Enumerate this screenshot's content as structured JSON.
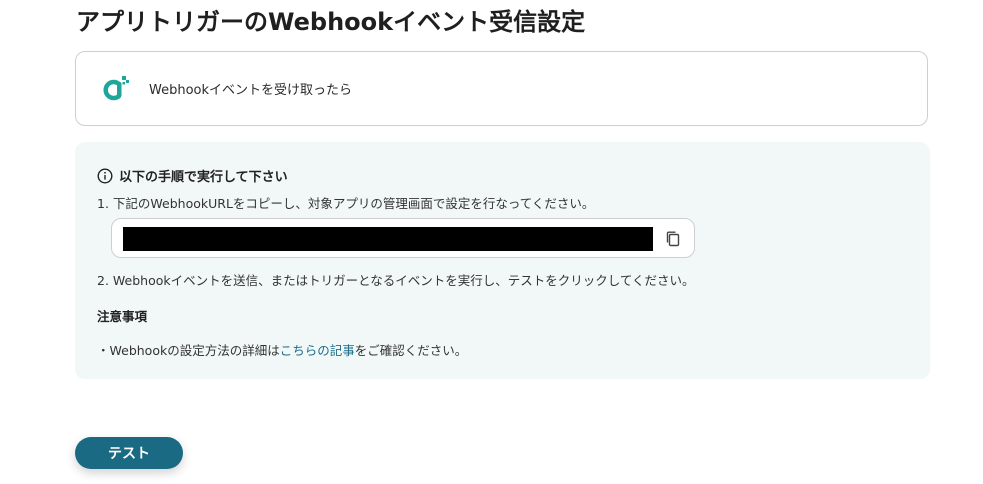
{
  "page": {
    "title": "アプリトリガーのWebhookイベント受信設定"
  },
  "trigger": {
    "icon": "webhook-app-icon",
    "label": "Webhookイベントを受け取ったら"
  },
  "instructions": {
    "heading": "以下の手順で実行して下さい",
    "step1": "1. 下記のWebhookURLをコピーし、対象アプリの管理画面で設定を行なってください。",
    "step2": "2. Webhookイベントを送信、またはトリガーとなるイベントを実行し、テストをクリックしてください。",
    "copy_icon": "copy-icon",
    "notes_heading": "注意事項",
    "notes_prefix": "・Webhookの設定方法の詳細は",
    "notes_link": "こちらの記事",
    "notes_suffix": "をご確認ください。"
  },
  "actions": {
    "test_label": "テスト"
  },
  "colors": {
    "accent": "#1b6a84",
    "panel_bg": "#f1f8f7",
    "icon_teal": "#1fa69b",
    "link": "#1e6c8a"
  }
}
